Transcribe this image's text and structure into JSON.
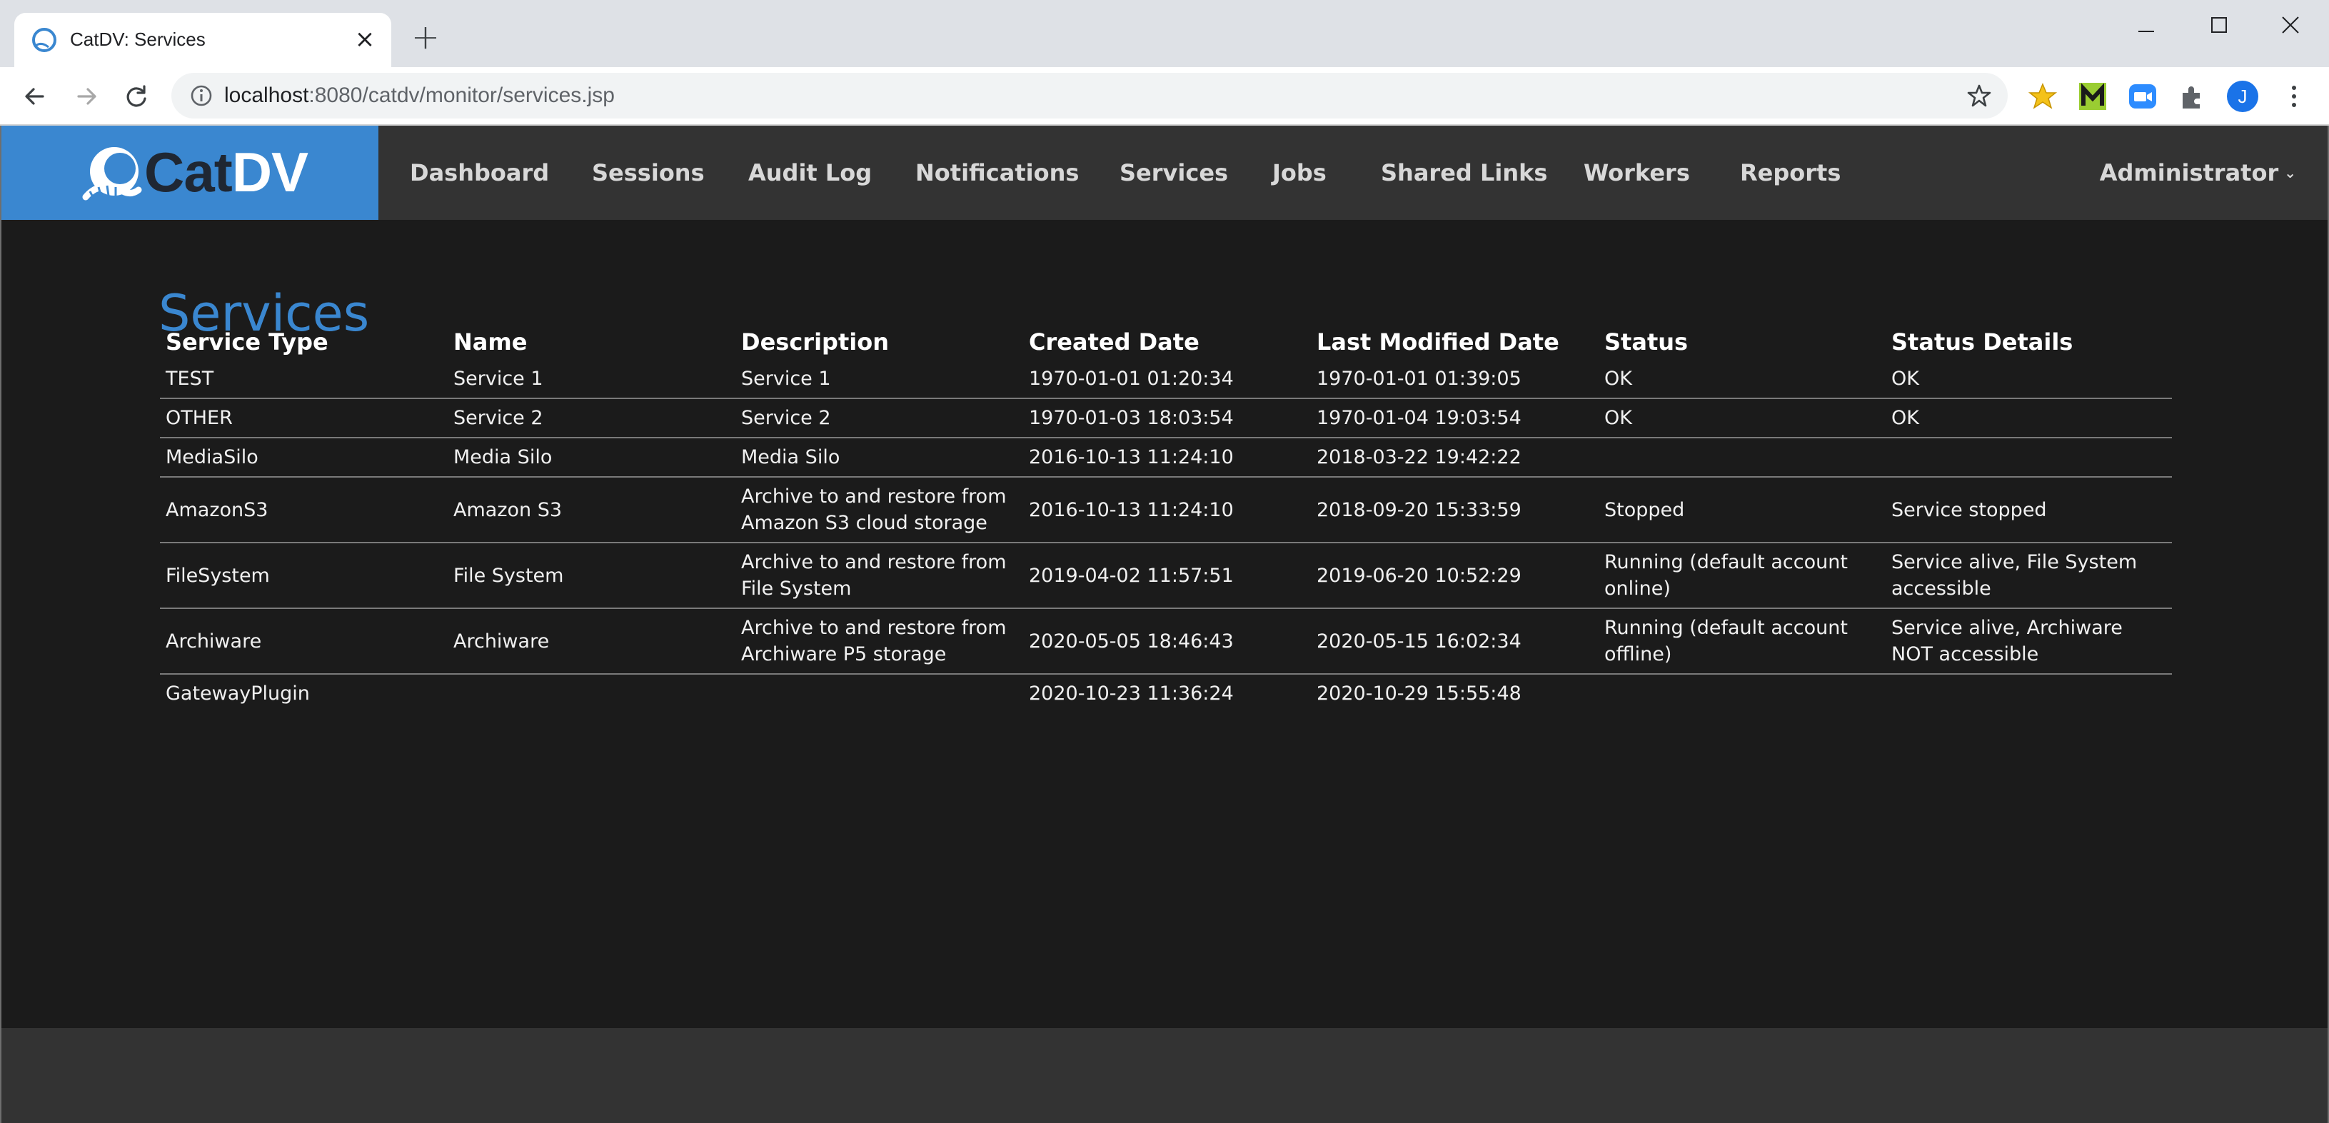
{
  "browser": {
    "tab_title": "CatDV: Services",
    "url_host": "localhost",
    "url_rest": ":8080/catdv/monitor/services.jsp",
    "profile_initial": "J"
  },
  "app": {
    "brand_cat": "Cat",
    "brand_dv": "DV",
    "nav": [
      "Dashboard",
      "Sessions",
      "Audit Log",
      "Notifications",
      "Services",
      "Jobs",
      "Shared Links",
      "Workers",
      "Reports"
    ],
    "user_menu": "Administrator",
    "accent_color": "#3a87d0"
  },
  "page": {
    "title": "Services",
    "columns": [
      "Service Type",
      "Name",
      "Description",
      "Created Date",
      "Last Modified Date",
      "Status",
      "Status Details"
    ],
    "rows": [
      [
        "TEST",
        "Service 1",
        "Service 1",
        "1970-01-01 01:20:34",
        "1970-01-01 01:39:05",
        "OK",
        "OK"
      ],
      [
        "OTHER",
        "Service 2",
        "Service 2",
        "1970-01-03 18:03:54",
        "1970-01-04 19:03:54",
        "OK",
        "OK"
      ],
      [
        "MediaSilo",
        "Media Silo",
        "Media Silo",
        "2016-10-13 11:24:10",
        "2018-03-22 19:42:22",
        "",
        ""
      ],
      [
        "AmazonS3",
        "Amazon S3",
        "Archive to and restore from Amazon S3 cloud storage",
        "2016-10-13 11:24:10",
        "2018-09-20 15:33:59",
        "Stopped",
        "Service stopped"
      ],
      [
        "FileSystem",
        "File System",
        "Archive to and restore from File System",
        "2019-04-02 11:57:51",
        "2019-06-20 10:52:29",
        "Running (default account online)",
        "Service alive, File System accessible"
      ],
      [
        "Archiware",
        "Archiware",
        "Archive to and restore from Archiware P5 storage",
        "2020-05-05 18:46:43",
        "2020-05-15 16:02:34",
        "Running (default account offline)",
        "Service alive, Archiware NOT accessible"
      ],
      [
        "GatewayPlugin",
        "",
        "",
        "2020-10-23 11:36:24",
        "2020-10-29 15:55:48",
        "",
        ""
      ]
    ]
  }
}
